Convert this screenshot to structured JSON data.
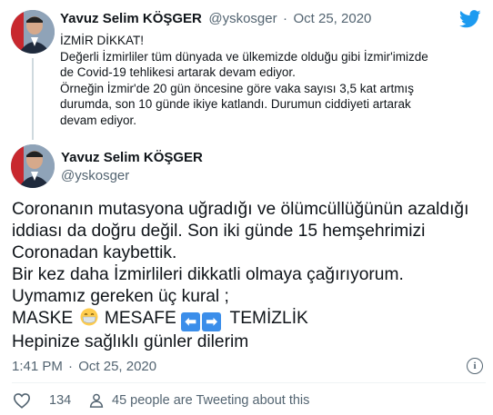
{
  "prev_tweet": {
    "name": "Yavuz Selim KÖŞGER",
    "handle": "@yskosger",
    "separator": "·",
    "date": "Oct 25, 2020",
    "lines": [
      "İZMİR DİKKAT!",
      "Değerli İzmirliler tüm dünyada ve ülkemizde olduğu gibi İzmir'imizde",
      "de Covid-19 tehlikesi artarak devam ediyor.",
      "Örneğin İzmir'de 20 gün öncesine göre vaka sayısı 3,5 kat artmış",
      "durumda, son 10 günde ikiye katlandı. Durumun ciddiyeti artarak",
      "devam ediyor."
    ]
  },
  "main_tweet": {
    "name": "Yavuz Selim KÖŞGER",
    "handle": "@yskosger",
    "lines": [
      "Coronanın mutasyona uğradığı ve ölümcüllüğünün azaldığı",
      "iddiası da doğru değil. Son iki günde 15 hemşehrimizi",
      "Coronadan kaybettik.",
      "Bir kez daha İzmirlileri dikkatli olmaya çağırıyorum.",
      "Uymamız gereken üç kural ;"
    ],
    "rules_line": {
      "word1": "MASKE",
      "word2": "MESAFE",
      "word3": "TEMİZLİK",
      "arrow_left": "⬅",
      "arrow_right": "➡"
    },
    "closing": "Hepinize sağlıklı günler dilerim",
    "time": "1:41 PM",
    "separator": "·",
    "date": "Oct 25, 2020"
  },
  "footer": {
    "likes": "134",
    "people_text": "45 people are Tweeting about this"
  },
  "colors": {
    "twitter_blue": "#1d9bf0",
    "like_red": "#f91880",
    "text_gray": "#536471"
  },
  "icons": [
    "twitter-bird-icon",
    "heart-icon",
    "person-icon",
    "info-icon",
    "mask-emoji-icon"
  ]
}
